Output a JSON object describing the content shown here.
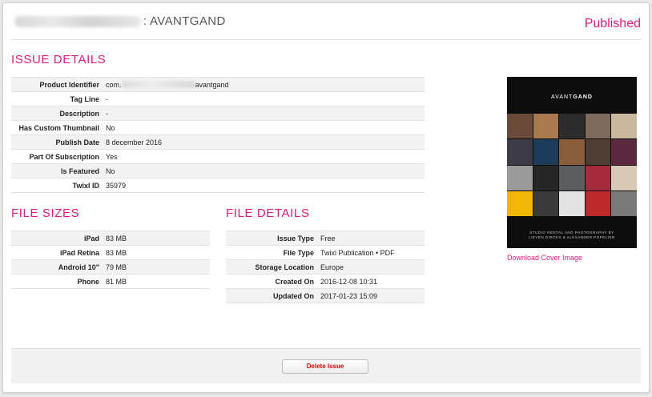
{
  "header": {
    "separator": ":",
    "publication": "AVANTGAND",
    "status": "Published"
  },
  "issue_details": {
    "title": "ISSUE DETAILS",
    "rows": [
      {
        "label": "Product Identifier",
        "value_prefix": "com.",
        "value_suffix": "avantgand"
      },
      {
        "label": "Tag Line",
        "value": "-"
      },
      {
        "label": "Description",
        "value": "-"
      },
      {
        "label": "Has Custom Thumbnail",
        "value": "No"
      },
      {
        "label": "Publish Date",
        "value": "8 december 2016"
      },
      {
        "label": "Part Of Subscription",
        "value": "Yes"
      },
      {
        "label": "Is Featured",
        "value": "No"
      },
      {
        "label": "Twixl ID",
        "value": "35979"
      }
    ]
  },
  "file_sizes": {
    "title": "FILE SIZES",
    "rows": [
      {
        "label": "iPad",
        "value": "83 MB"
      },
      {
        "label": "iPad Retina",
        "value": "83 MB"
      },
      {
        "label": "Android 10\"",
        "value": "79 MB"
      },
      {
        "label": "Phone",
        "value": "81 MB"
      }
    ]
  },
  "file_details": {
    "title": "FILE DETAILS",
    "rows": [
      {
        "label": "Issue Type",
        "value": "Free"
      },
      {
        "label": "File Type",
        "value": "Twixl Publication • PDF"
      },
      {
        "label": "Storage Location",
        "value": "Europe"
      },
      {
        "label": "Created On",
        "value": "2016-12-08 10:31"
      },
      {
        "label": "Updated On",
        "value": "2017-01-23 15:09"
      }
    ]
  },
  "cover": {
    "title_light": "AVANT",
    "title_bold": "GAND",
    "credit_line1": "STUDIO RENTAL AND PHOTOGRAPHY BY",
    "credit_line2": "LIEVEN DIRCKX & ALEXANDER POPELIER",
    "download_label": "Download Cover Image",
    "tile_colors": [
      "#6b4a3a",
      "#a8794f",
      "#2c2c2c",
      "#7d6a5c",
      "#c9b89c",
      "#3d3b45",
      "#1d3c5a",
      "#8a5d3b",
      "#4e3d32",
      "#5b2840",
      "#9a9a9a",
      "#262626",
      "#5c5d60",
      "#a52a3a",
      "#d8c9b6",
      "#f2b705",
      "#3a3a3a",
      "#e3e3e3",
      "#bd2a2a",
      "#7a7a7a"
    ]
  },
  "footer": {
    "delete_label": "Delete Issue"
  }
}
